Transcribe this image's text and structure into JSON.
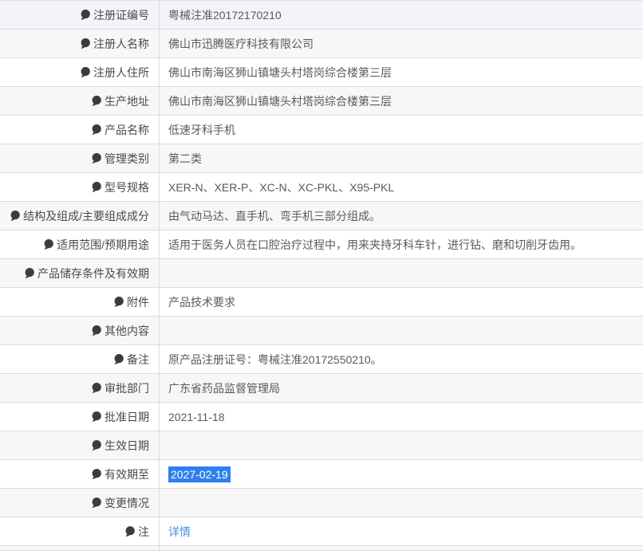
{
  "colors": {
    "selection_highlight": "#2e80f0",
    "link_blue": "#4a90e2",
    "row_shade": "#f7f7f7",
    "first_row_tint": "#f2f4f9",
    "border": "#dcdcdc"
  },
  "table": {
    "rows": [
      {
        "label": "注册证编号",
        "value": "粤械注准20172170210"
      },
      {
        "label": "注册人名称",
        "value": "佛山市迅腾医疗科技有限公司"
      },
      {
        "label": "注册人住所",
        "value": "佛山市南海区狮山镇塘头村塔岗综合楼第三层"
      },
      {
        "label": "生产地址",
        "value": "佛山市南海区狮山镇塘头村塔岗综合楼第三层"
      },
      {
        "label": "产品名称",
        "value": "低速牙科手机"
      },
      {
        "label": "管理类别",
        "value": "第二类"
      },
      {
        "label": "型号规格",
        "value": "XER-N、XER-P、XC-N、XC-PKL、X95-PKL"
      },
      {
        "label": "结构及组成/主要组成成分",
        "value": "由气动马达、直手机、弯手机三部分组成。"
      },
      {
        "label": "适用范围/预期用途",
        "value": "适用于医务人员在口腔治疗过程中，用来夹持牙科车针，进行钻、磨和切削牙齿用。"
      },
      {
        "label": "产品储存条件及有效期",
        "value": ""
      },
      {
        "label": "附件",
        "value": "产品技术要求"
      },
      {
        "label": "其他内容",
        "value": ""
      },
      {
        "label": "备注",
        "value": "原产品注册证号：粤械注准20172550210。"
      },
      {
        "label": "审批部门",
        "value": "广东省药品监督管理局"
      },
      {
        "label": "批准日期",
        "value": "2021-11-18"
      },
      {
        "label": "生效日期",
        "value": ""
      },
      {
        "label": "有效期至",
        "value": "2027-02-19",
        "highlighted": true
      },
      {
        "label": "变更情况",
        "value": ""
      },
      {
        "label": "注",
        "value": "详情",
        "link": true,
        "icon": "lightbulb-icon"
      }
    ]
  }
}
